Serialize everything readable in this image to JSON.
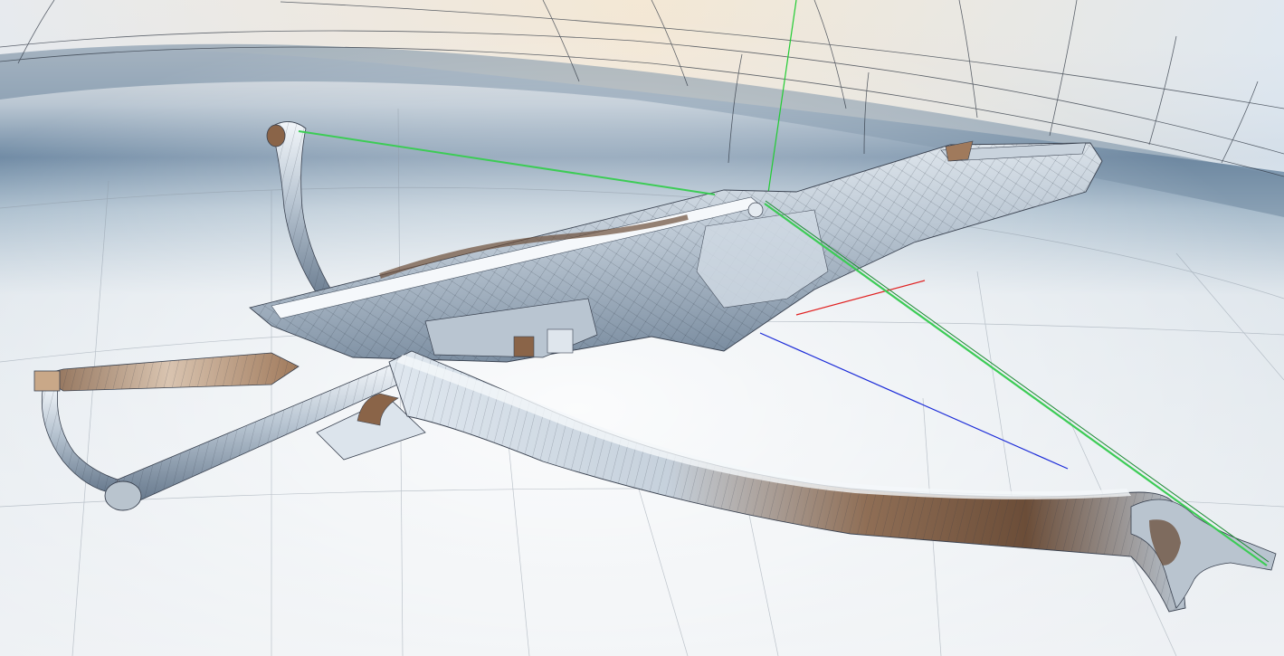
{
  "viewport": {
    "scene": "crossbow-3d-model",
    "render_mode": "wireframe-on-shaded",
    "material": "chrome"
  },
  "axes": {
    "x_axis_color": "#e02020",
    "y_axis_color": "#22cc33",
    "z_axis_color": "#1a2ad8"
  },
  "bow_string_color": "#3ccc55",
  "colors": {
    "sky_top": "#e9e3d9",
    "horizon_dark": "#5f7a95",
    "floor_light": "#e8ecf0",
    "metal_light": "#eef3f8",
    "metal_mid": "#aebccb",
    "metal_dark": "#5d6f82",
    "bronze": "#8a6448",
    "wire": "#3a4250"
  }
}
